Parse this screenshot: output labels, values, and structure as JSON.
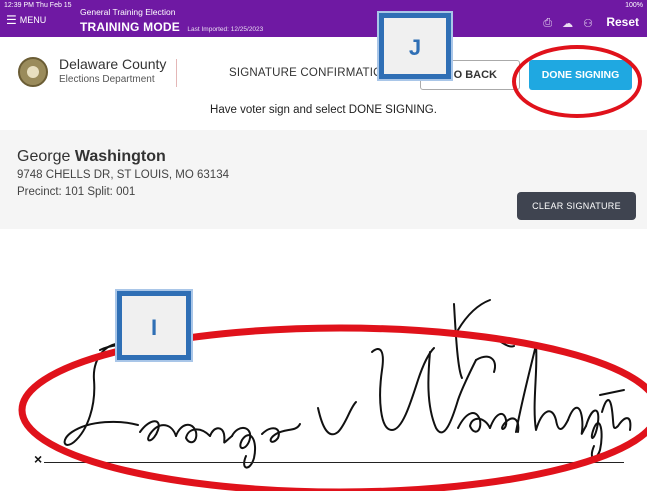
{
  "status_bar": {
    "time": "12:39 PM  Thu Feb 15",
    "battery": "100%"
  },
  "topbar": {
    "menu_label": "MENU",
    "election_name": "General Training Election",
    "mode": "TRAINING MODE",
    "last_imported": "Last Imported: 12/25/2023",
    "reset_label": "Reset",
    "icons": [
      "printer-icon",
      "cloud-upload-icon",
      "users-icon"
    ]
  },
  "header": {
    "county": "Delaware County",
    "department": "Elections Department",
    "title": "SIGNATURE CONFIRMATION",
    "go_back_label": "GO BACK",
    "done_label": "DONE SIGNING"
  },
  "instruction": "Have voter sign and select DONE SIGNING.",
  "voter": {
    "first_name": "George",
    "last_name": "Washington",
    "address": "9748 CHELLS DR, ST LOUIS, MO 63134",
    "precinct": "Precinct: 101 Split: 001"
  },
  "clear_label": "CLEAR SIGNATURE",
  "signature_mark": "×",
  "callouts": {
    "done": "J",
    "signature": "I"
  },
  "colors": {
    "topbar": "#6f19a3",
    "done_button": "#1fa8e1",
    "clear_button": "#3f4450",
    "annotation_red": "#e0121b",
    "callout_blue": "#2f6fb5"
  }
}
